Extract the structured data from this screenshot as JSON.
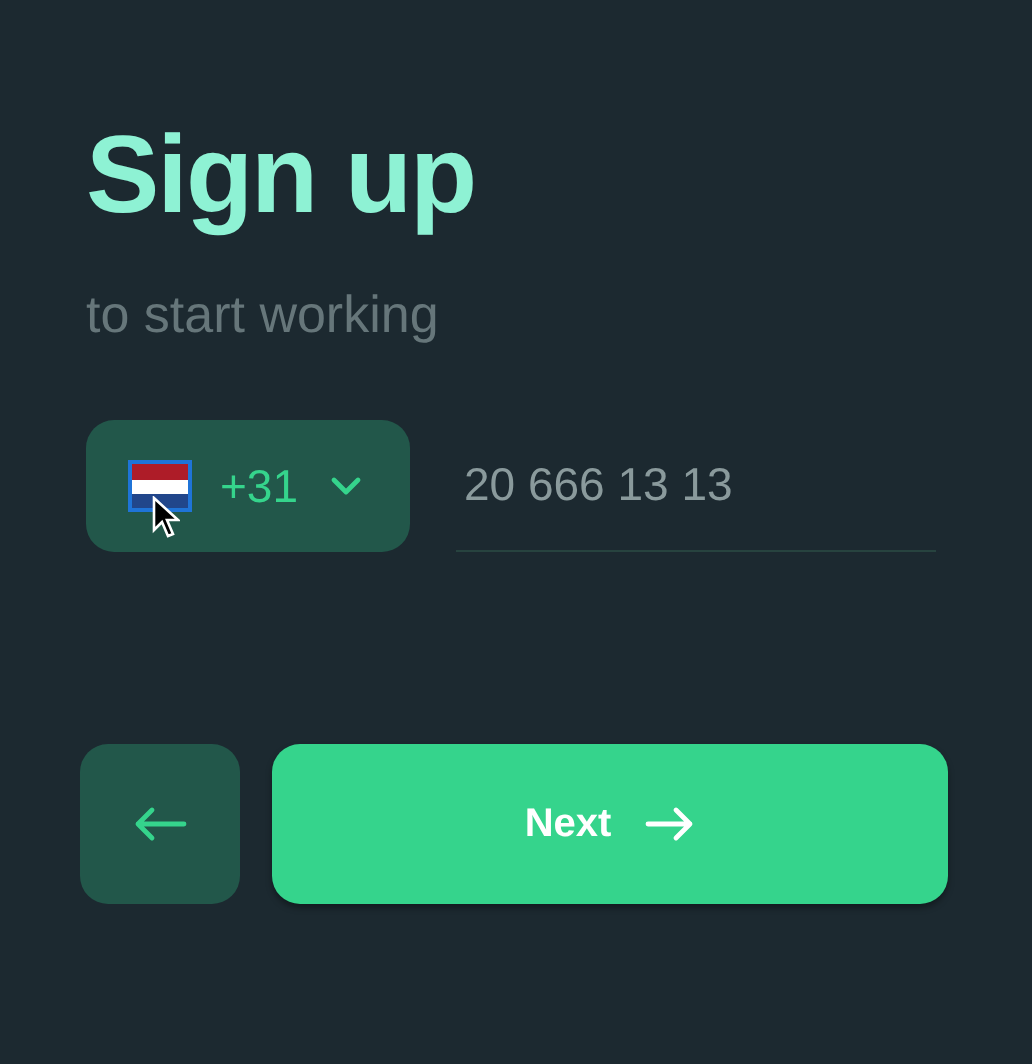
{
  "title": "Sign up",
  "subtitle": "to start working",
  "country": {
    "dial_code": "+31",
    "selected": true
  },
  "phone": {
    "placeholder": "20 666 13 13"
  },
  "next_button": {
    "label": "Next"
  }
}
